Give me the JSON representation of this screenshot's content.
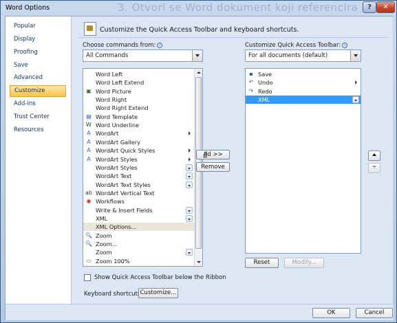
{
  "window": {
    "title": "Word Options",
    "background_text": "3.    Otvori se Word dokument koji referencira šemu"
  },
  "nav": {
    "items": [
      {
        "label": "Popular"
      },
      {
        "label": "Display"
      },
      {
        "label": "Proofing"
      },
      {
        "label": "Save"
      },
      {
        "label": "Advanced"
      },
      {
        "label": "Customize"
      },
      {
        "label": "Add-Ins"
      },
      {
        "label": "Trust Center"
      },
      {
        "label": "Resources"
      }
    ],
    "active": "Customize"
  },
  "header": {
    "text": "Customize the Quick Access Toolbar and keyboard shortcuts."
  },
  "left": {
    "label": "Choose commands from:",
    "combo_value": "All Commands",
    "commands": [
      {
        "label": "Word Left",
        "icon": "none"
      },
      {
        "label": "Word Left Extend",
        "icon": "none"
      },
      {
        "label": "Word Picture",
        "icon": "picture-icon"
      },
      {
        "label": "Word Right",
        "icon": "none"
      },
      {
        "label": "Word Right Extend",
        "icon": "none"
      },
      {
        "label": "Word Template",
        "icon": "template-icon"
      },
      {
        "label": "Word Underline",
        "icon": "underline-icon"
      },
      {
        "label": "WordArt",
        "icon": "wordart-icon",
        "sub": "arrow"
      },
      {
        "label": "WordArt Gallery",
        "icon": "wordart-gallery-icon"
      },
      {
        "label": "WordArt Quick Styles",
        "icon": "wordart-styles-icon",
        "sub": "arrow"
      },
      {
        "label": "WordArt Styles",
        "icon": "wordart-styles-icon",
        "sub": "arrow"
      },
      {
        "label": "WordArt Styles",
        "icon": "none",
        "sub": "dropdown"
      },
      {
        "label": "WordArt Text",
        "icon": "none",
        "sub": "dropdown"
      },
      {
        "label": "WordArt Text Styles",
        "icon": "none",
        "sub": "dropdown"
      },
      {
        "label": "WordArt Vertical Text",
        "icon": "vertical-text-icon"
      },
      {
        "label": "Workflows",
        "icon": "workflow-icon"
      },
      {
        "label": "Write & Insert Fields",
        "icon": "none",
        "sub": "dropdown"
      },
      {
        "label": "XML",
        "icon": "none",
        "sub": "dropdown"
      },
      {
        "label": "XML Options...",
        "icon": "none",
        "highlight": true
      },
      {
        "label": "Zoom",
        "icon": "zoom-icon"
      },
      {
        "label": "Zoom...",
        "icon": "zoom-icon"
      },
      {
        "label": "Zoom",
        "icon": "none",
        "sub": "dropdown"
      },
      {
        "label": "Zoom 100%",
        "icon": "zoom100-icon"
      }
    ]
  },
  "middle": {
    "add_label": "Add >>",
    "remove_label": "Remove"
  },
  "right": {
    "label": "Customize Quick Access Toolbar:",
    "combo_value": "For all documents (default)",
    "items": [
      {
        "label": "Save",
        "icon": "save-icon"
      },
      {
        "label": "Undo",
        "icon": "undo-icon",
        "sub": "arrow"
      },
      {
        "label": "Redo",
        "icon": "redo-icon"
      },
      {
        "label": "XML",
        "icon": "none",
        "sub": "dropdown",
        "selected": true
      }
    ],
    "reset_label": "Reset",
    "modify_label": "Modify..."
  },
  "show_below": {
    "label": "Show Quick Access Toolbar below the Ribbon",
    "checked": false
  },
  "shortcuts": {
    "label": "Keyboard shortcuts:",
    "button": "Customize..."
  },
  "footer": {
    "ok": "OK",
    "cancel": "Cancel"
  },
  "colors": {
    "selection": "#3399ff",
    "nav_active": "#f8c34a",
    "panel": "#dde7f3"
  }
}
